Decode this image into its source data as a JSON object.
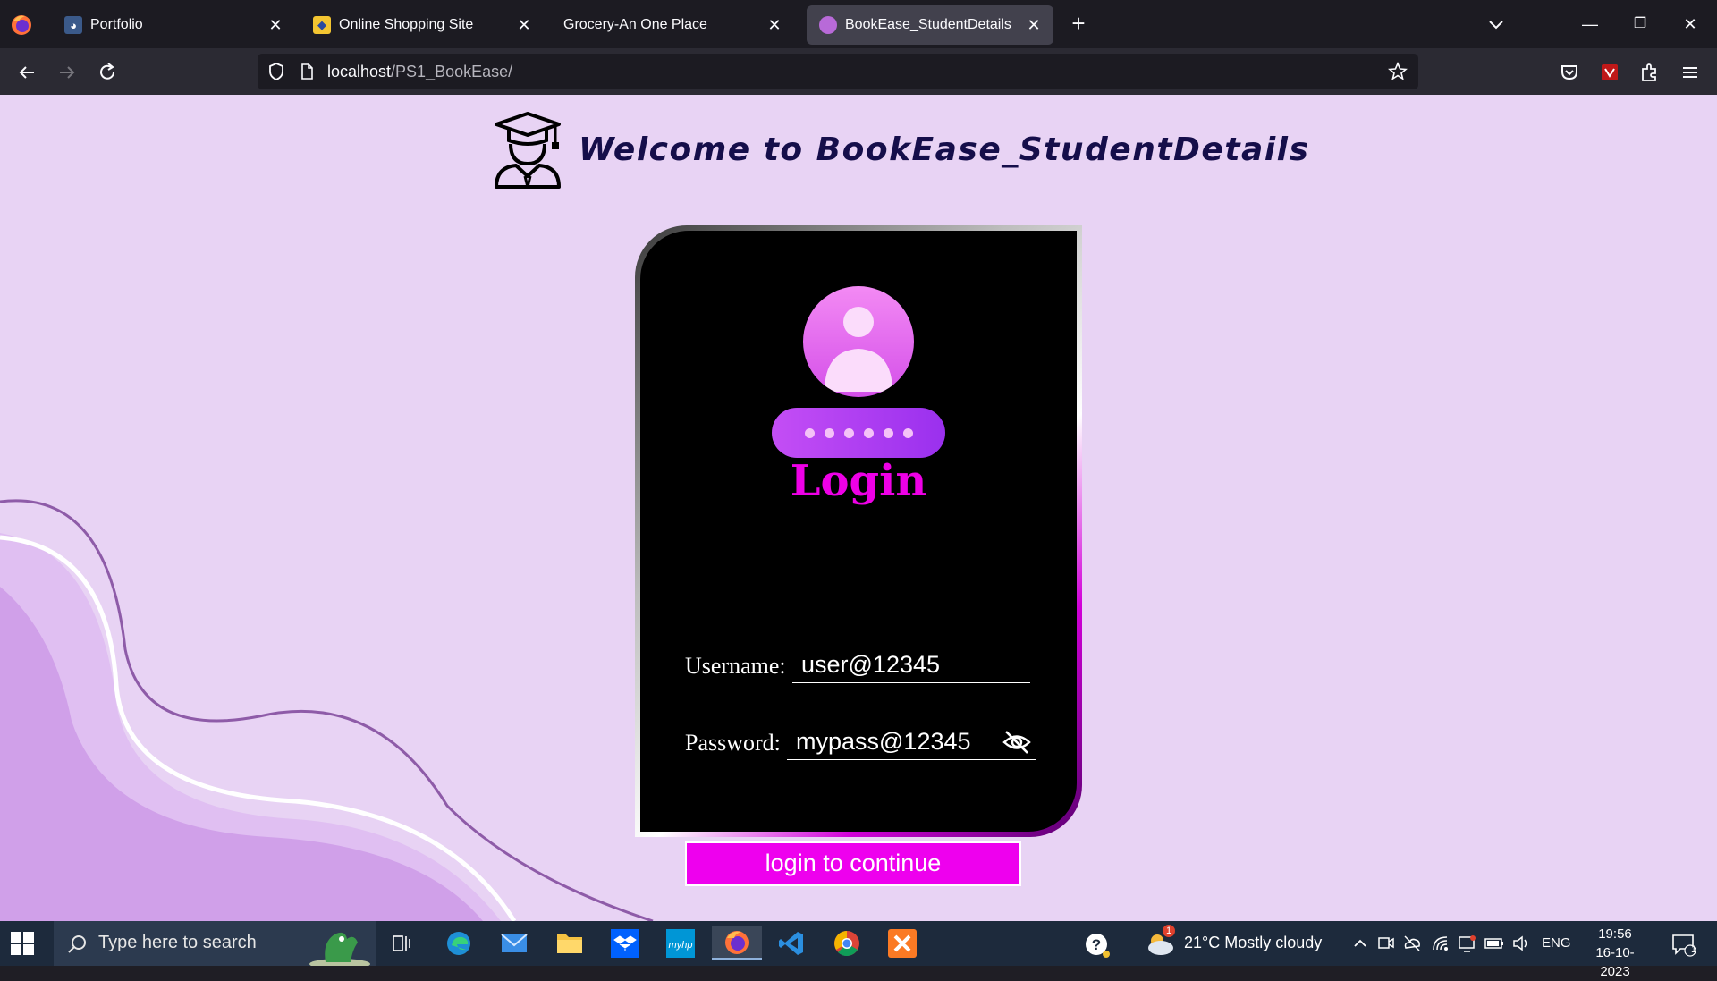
{
  "browser": {
    "tabs": [
      {
        "title": "Portfolio",
        "active": false
      },
      {
        "title": "Online Shopping Site",
        "active": false
      },
      {
        "title": "Grocery-An One Place",
        "active": false
      },
      {
        "title": "BookEase_StudentDetails",
        "active": true
      }
    ],
    "url": {
      "host": "localhost",
      "path": "/PS1_BookEase/"
    }
  },
  "page": {
    "header_title": "Welcome to BookEase_StudentDetails",
    "login": {
      "title": "Login",
      "username_label": "Username:",
      "username_value": "user@12345",
      "password_label": "Password:",
      "password_value": "mypass@12345",
      "submit_label": "login to continue",
      "masked_dots": 6
    },
    "colors": {
      "background": "#e8d3f4",
      "accent": "#ee00ee",
      "card": "#000000",
      "title": "#150e4a"
    }
  },
  "taskbar": {
    "search_placeholder": "Type here to search",
    "weather": "21°C  Mostly cloudy",
    "weather_badge": "1",
    "language": "ENG",
    "time": "19:56",
    "date": "16-10-2023",
    "notification_count": "1"
  }
}
